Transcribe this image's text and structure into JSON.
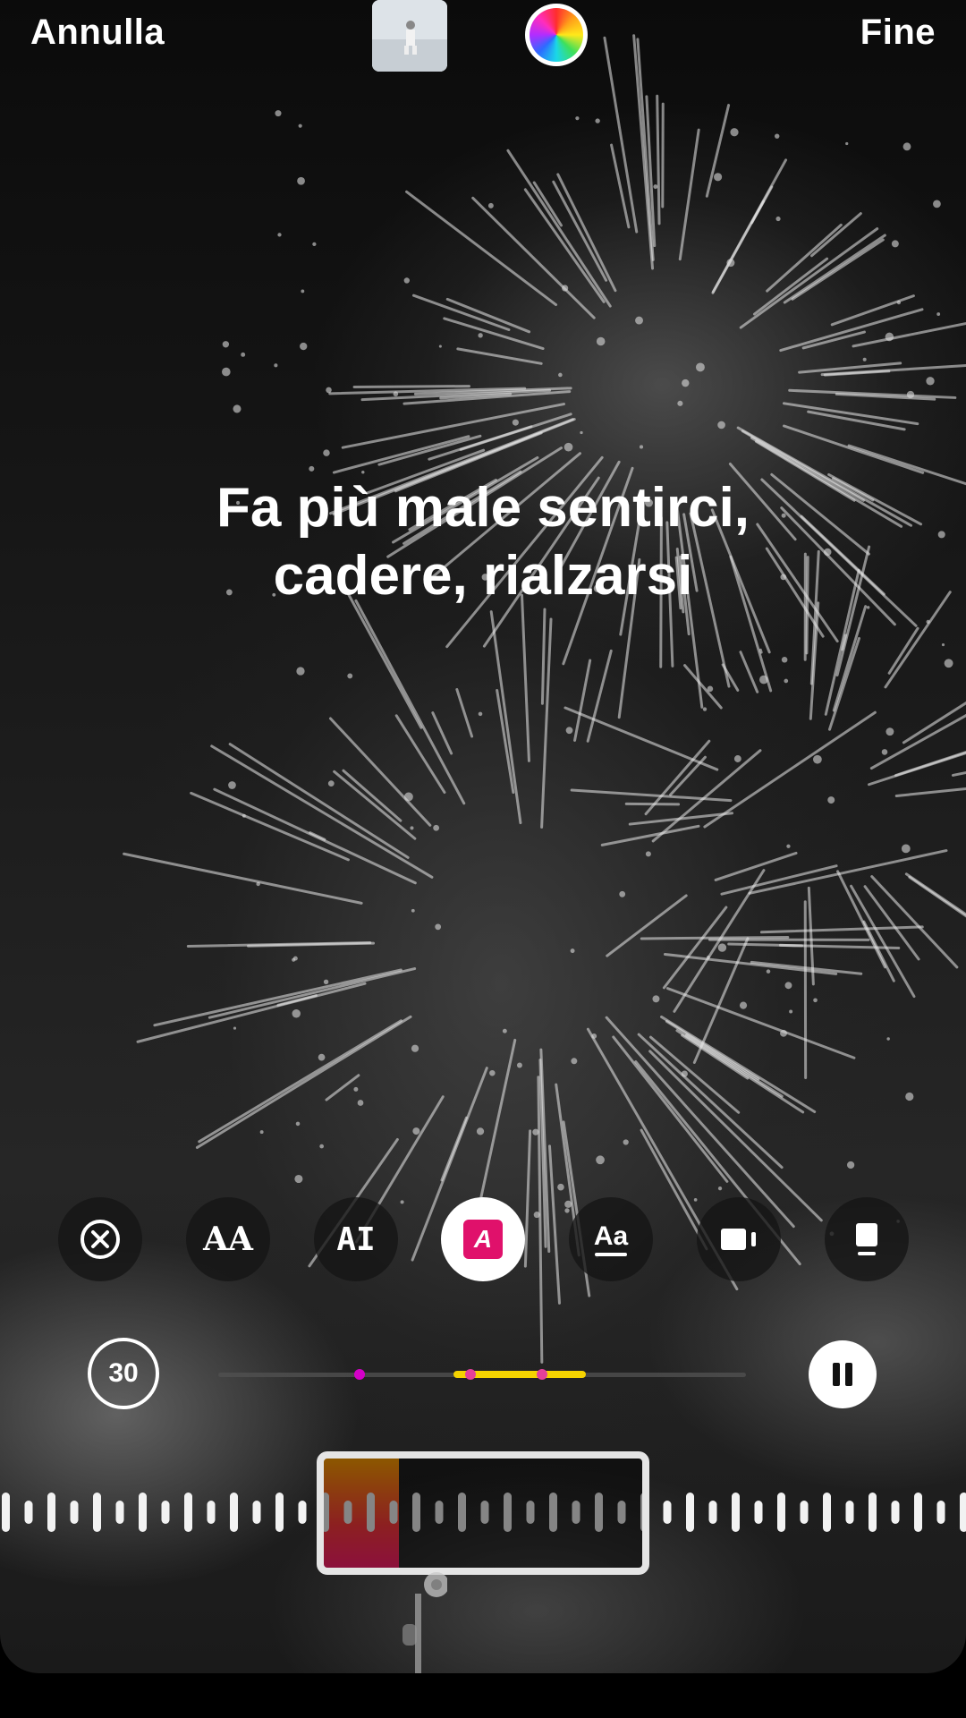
{
  "top_bar": {
    "cancel_label": "Annulla",
    "done_label": "Fine",
    "thumbnail_icon": "album-cover-thumbnail",
    "color_picker_icon": "color-wheel-icon"
  },
  "lyrics": {
    "line1": "Fa più male sentirci,",
    "line2": "cadere, rialzarsi"
  },
  "style_bar": {
    "items": [
      {
        "icon": "close-circle-icon",
        "label": ""
      },
      {
        "icon": "font-size-icon",
        "label": "AA"
      },
      {
        "icon": "typewriter-style-icon",
        "label": "AI"
      },
      {
        "icon": "highlight-style-icon",
        "label": "A",
        "selected": true
      },
      {
        "icon": "underline-style-icon",
        "label": "Aa"
      },
      {
        "icon": "video-card-icon",
        "label": ""
      },
      {
        "icon": "card-style-icon",
        "label": ""
      }
    ],
    "accent_color": "#e0116b"
  },
  "timeline": {
    "duration_label": "30",
    "play_state": "playing",
    "pause_icon": "pause-icon",
    "selection_color": "#f5d300",
    "marker_color": "#d400c8"
  },
  "waveform": {
    "selection_gradient": [
      "#ff9f00",
      "#ff1f6e"
    ]
  }
}
